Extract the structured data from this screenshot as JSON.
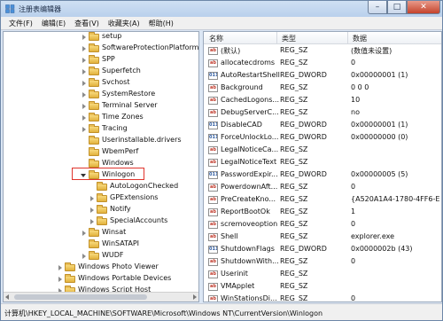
{
  "window": {
    "title": "注册表编辑器",
    "controls": {
      "minimize": "–",
      "maximize": "□",
      "close": "✕"
    }
  },
  "menu": [
    "文件(F)",
    "编辑(E)",
    "查看(V)",
    "收藏夹(A)",
    "帮助(H)"
  ],
  "tree": {
    "items": [
      {
        "label": "setup",
        "expander": "collapsed"
      },
      {
        "label": "SoftwareProtectionPlatform",
        "expander": "collapsed"
      },
      {
        "label": "SPP",
        "expander": "collapsed"
      },
      {
        "label": "Superfetch",
        "expander": "collapsed"
      },
      {
        "label": "Svchost",
        "expander": "collapsed"
      },
      {
        "label": "SystemRestore",
        "expander": "collapsed"
      },
      {
        "label": "Terminal Server",
        "expander": "collapsed"
      },
      {
        "label": "Time Zones",
        "expander": "collapsed"
      },
      {
        "label": "Tracing",
        "expander": "collapsed"
      },
      {
        "label": "Userinstallable.drivers",
        "expander": "none"
      },
      {
        "label": "WbemPerf",
        "expander": "none"
      },
      {
        "label": "Windows",
        "expander": "none"
      },
      {
        "label": "Winlogon",
        "expander": "expanded",
        "highlighted": true
      },
      {
        "label": "AutoLogonChecked",
        "expander": "none"
      },
      {
        "label": "GPExtensions",
        "expander": "collapsed"
      },
      {
        "label": "Notify",
        "expander": "collapsed"
      },
      {
        "label": "SpecialAccounts",
        "expander": "collapsed"
      },
      {
        "label": "Winsat",
        "expander": "collapsed"
      },
      {
        "label": "WinSATAPI",
        "expander": "none"
      },
      {
        "label": "WUDF",
        "expander": "collapsed"
      },
      {
        "label": "Windows Photo Viewer",
        "expander": "collapsed"
      },
      {
        "label": "Windows Portable Devices",
        "expander": "collapsed"
      },
      {
        "label": "Windows Script Host",
        "expander": "collapsed"
      }
    ]
  },
  "values": {
    "columns": {
      "name": "名称",
      "type": "类型",
      "data": "数据"
    },
    "rows": [
      {
        "icon": "ab",
        "name": "(默认)",
        "type": "REG_SZ",
        "data": "(数值未设置)"
      },
      {
        "icon": "ab",
        "name": "allocatecdroms",
        "type": "REG_SZ",
        "data": "0"
      },
      {
        "icon": "bin",
        "name": "AutoRestartShell",
        "type": "REG_DWORD",
        "data": "0x00000001 (1)"
      },
      {
        "icon": "ab",
        "name": "Background",
        "type": "REG_SZ",
        "data": "0 0 0"
      },
      {
        "icon": "ab",
        "name": "CachedLogons...",
        "type": "REG_SZ",
        "data": "10"
      },
      {
        "icon": "ab",
        "name": "DebugServerC...",
        "type": "REG_SZ",
        "data": "no"
      },
      {
        "icon": "bin",
        "name": "DisableCAD",
        "type": "REG_DWORD",
        "data": "0x00000001 (1)"
      },
      {
        "icon": "bin",
        "name": "ForceUnlockLo...",
        "type": "REG_DWORD",
        "data": "0x00000000 (0)"
      },
      {
        "icon": "ab",
        "name": "LegalNoticeCa...",
        "type": "REG_SZ",
        "data": ""
      },
      {
        "icon": "ab",
        "name": "LegalNoticeText",
        "type": "REG_SZ",
        "data": ""
      },
      {
        "icon": "bin",
        "name": "PasswordExpir...",
        "type": "REG_DWORD",
        "data": "0x00000005 (5)"
      },
      {
        "icon": "ab",
        "name": "PowerdownAft...",
        "type": "REG_SZ",
        "data": "0"
      },
      {
        "icon": "ab",
        "name": "PreCreateKno...",
        "type": "REG_SZ",
        "data": "{A520A1A4-1780-4FF6-E"
      },
      {
        "icon": "ab",
        "name": "ReportBootOk",
        "type": "REG_SZ",
        "data": "1"
      },
      {
        "icon": "ab",
        "name": "scremoveoption",
        "type": "REG_SZ",
        "data": "0"
      },
      {
        "icon": "ab",
        "name": "Shell",
        "type": "REG_SZ",
        "data": "explorer.exe"
      },
      {
        "icon": "bin",
        "name": "ShutdownFlags",
        "type": "REG_DWORD",
        "data": "0x0000002b (43)"
      },
      {
        "icon": "ab",
        "name": "ShutdownWith...",
        "type": "REG_SZ",
        "data": "0"
      },
      {
        "icon": "ab",
        "name": "Userinit",
        "type": "REG_SZ",
        "data": ""
      },
      {
        "icon": "ab",
        "name": "VMApplet",
        "type": "REG_SZ",
        "data": ""
      },
      {
        "icon": "ab",
        "name": "WinStationsDi...",
        "type": "REG_SZ",
        "data": "0"
      }
    ]
  },
  "status": {
    "path": "计算机\\HKEY_LOCAL_MACHINE\\SOFTWARE\\Microsoft\\Windows NT\\CurrentVersion\\Winlogon"
  }
}
